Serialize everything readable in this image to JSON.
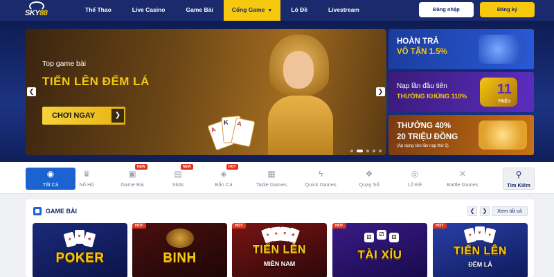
{
  "header": {
    "logo_text": "SKY88",
    "nav": [
      "Thể Thao",
      "Live Casino",
      "Game Bài",
      "Cổng Game",
      "Lô Đề",
      "Livestream"
    ],
    "login_label": "Đăng nhập",
    "register_label": "Đăng ký"
  },
  "hero": {
    "subtitle": "Top game bài",
    "title": "TIẾN LÊN ĐẾM LÁ",
    "cta_label": "CHƠI NGAY",
    "prev_icon": "chevron-left-icon",
    "next_icon": "chevron-right-icon",
    "cards": [
      "A",
      "K",
      "A"
    ]
  },
  "promos": [
    {
      "line1": "HOÀN TRẢ",
      "line2": "VÔ TẬN 1.5%"
    },
    {
      "line1": "Nạp lần đầu tiên",
      "line2": "THƯỞNG KHỦNG 110%",
      "art_number": "11",
      "art_sub": "TRIỆU"
    },
    {
      "line1": "THƯỞNG 40%",
      "line2": "20 TRIỆU ĐỒNG",
      "small": "(Áp dụng cho lần nạp thứ 2)"
    }
  ],
  "categories": [
    {
      "label": "Tất Cả",
      "icon": "all-icon"
    },
    {
      "label": "Nổ Hũ",
      "icon": "jackpot-icon"
    },
    {
      "label": "Game Bài",
      "icon": "cards-icon",
      "badge": "NEW"
    },
    {
      "label": "Slots",
      "icon": "slot-icon",
      "badge": "NEW"
    },
    {
      "label": "Bắn Cá",
      "icon": "fish-icon",
      "badge": "HOT"
    },
    {
      "label": "Table Games",
      "icon": "table-icon"
    },
    {
      "label": "Quick Games",
      "icon": "lightning-icon"
    },
    {
      "label": "Quay Số",
      "icon": "lottery-icon"
    },
    {
      "label": "Lô Đề",
      "icon": "lotto-icon"
    },
    {
      "label": "Battle Games",
      "icon": "swords-icon"
    },
    {
      "label": "Tìm Kiếm",
      "icon": "search-icon"
    }
  ],
  "section": {
    "title": "GAME BÀI",
    "see_all_label": "Xem tất cả",
    "tiles": [
      {
        "name": "POKER",
        "sub": "",
        "hot": ""
      },
      {
        "name": "BINH",
        "sub": "",
        "hot": "HOT"
      },
      {
        "name": "TIẾN LÊN",
        "sub": "MIỀN NAM",
        "hot": "HOT"
      },
      {
        "name": "TÀI XỈU",
        "sub": "",
        "hot": "HOT"
      },
      {
        "name": "TIẾN LÊN",
        "sub": "ĐẾM LÁ",
        "hot": "HOT"
      }
    ]
  },
  "colors": {
    "brand_navy": "#1a2a6c",
    "accent_yellow": "#f6c90e",
    "active_blue": "#1a63d0",
    "hot_red": "#e0341e"
  }
}
